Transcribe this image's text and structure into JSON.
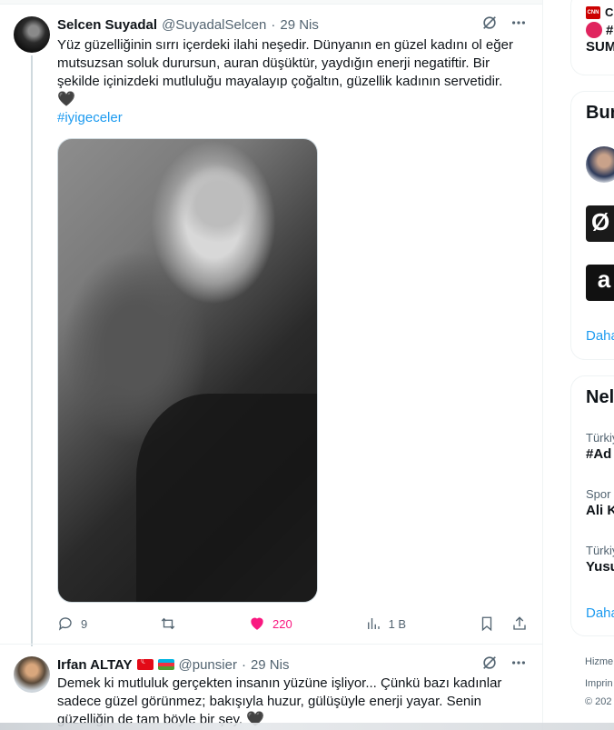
{
  "tweets": [
    {
      "name": "Selcen Suyadal",
      "handle": "@SuyadalSelcen",
      "separator": "·",
      "date": "29 Nis",
      "text": "Yüz güzelliğinin sırrı içerdeki ilahi neşedir. Dünyanın en güzel kadını ol eğer mutsuzsan soluk durursun, auran düşüktür, yaydığın enerji negatiftir. Bir şekilde içinizdeki mutluluğu mayalayıp çoğaltın, güzellik kadının servetidir.",
      "emoji": "🖤",
      "hashtag": "#iyigeceler",
      "stats": {
        "replies": "9",
        "likes": "220",
        "views": "1 B"
      }
    },
    {
      "name": "Irfan ALTAY",
      "handle": "@punsier",
      "separator": "·",
      "date": "29 Nis",
      "text": "Demek ki mutluluk gerçekten insanın yüzüne işliyor... Çünkü bazı kadınlar sadece güzel görünmez; bakışıyla huzur, gülüşüyle enerji yayar. Senin güzelliğin de tam böyle bir şey.",
      "emoji": "🖤"
    }
  ],
  "sidebar": {
    "news": {
      "source": "CN",
      "line1": "#",
      "line2": "SUM"
    },
    "follow": {
      "title": "Bun",
      "more": "Daha",
      "third_avatar_text": "a"
    },
    "trends": {
      "title": "Nel",
      "items": [
        {
          "category": "Türkiy",
          "title": "#Ad"
        },
        {
          "category": "Spor",
          "title": "Ali K"
        },
        {
          "category": "Türkiy",
          "title": "Yusu"
        }
      ],
      "more": "Daha"
    },
    "footer": [
      "Hizme",
      "Imprin",
      "© 202"
    ]
  },
  "colors": {
    "accent": "#1d9bf0",
    "like": "#f91880",
    "muted": "#536471"
  }
}
